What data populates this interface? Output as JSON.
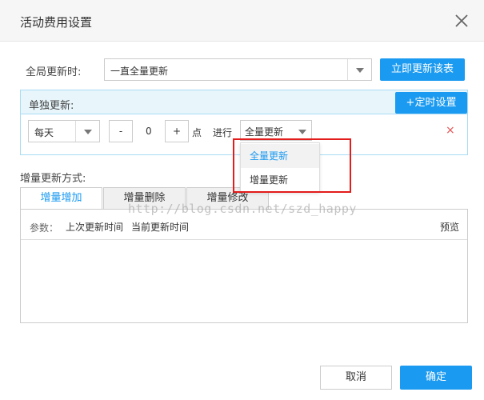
{
  "dialog": {
    "title": "活动费用设置",
    "close_icon": "close-icon"
  },
  "global": {
    "label": "全局更新时:",
    "select_value": "一直全量更新",
    "refresh_button": "立即更新该表"
  },
  "single": {
    "title": "单独更新:",
    "schedule_button": "+定时设置",
    "period": "每天",
    "minus": "-",
    "hour": "0",
    "plus": "+",
    "hour_unit": "点",
    "action_label": "进行",
    "mode_value": "全量更新",
    "delete": "×"
  },
  "dropdown": {
    "options": [
      "全量更新",
      "增量更新"
    ],
    "selected": "全量更新"
  },
  "incremental": {
    "label": "增量更新方式:",
    "tabs": [
      "增量增加",
      "增量删除",
      "增量修改"
    ],
    "active_tab": "增量增加",
    "params_label": "参数：",
    "params": [
      "上次更新时间",
      "当前更新时间"
    ],
    "preview": "预览"
  },
  "watermark": "http://blog.csdn.net/szd_happy",
  "footer": {
    "cancel": "取消",
    "ok": "确定"
  },
  "colors": {
    "accent": "#1a9af1",
    "highlight": "#e31c1c",
    "delete": "#e55353"
  }
}
